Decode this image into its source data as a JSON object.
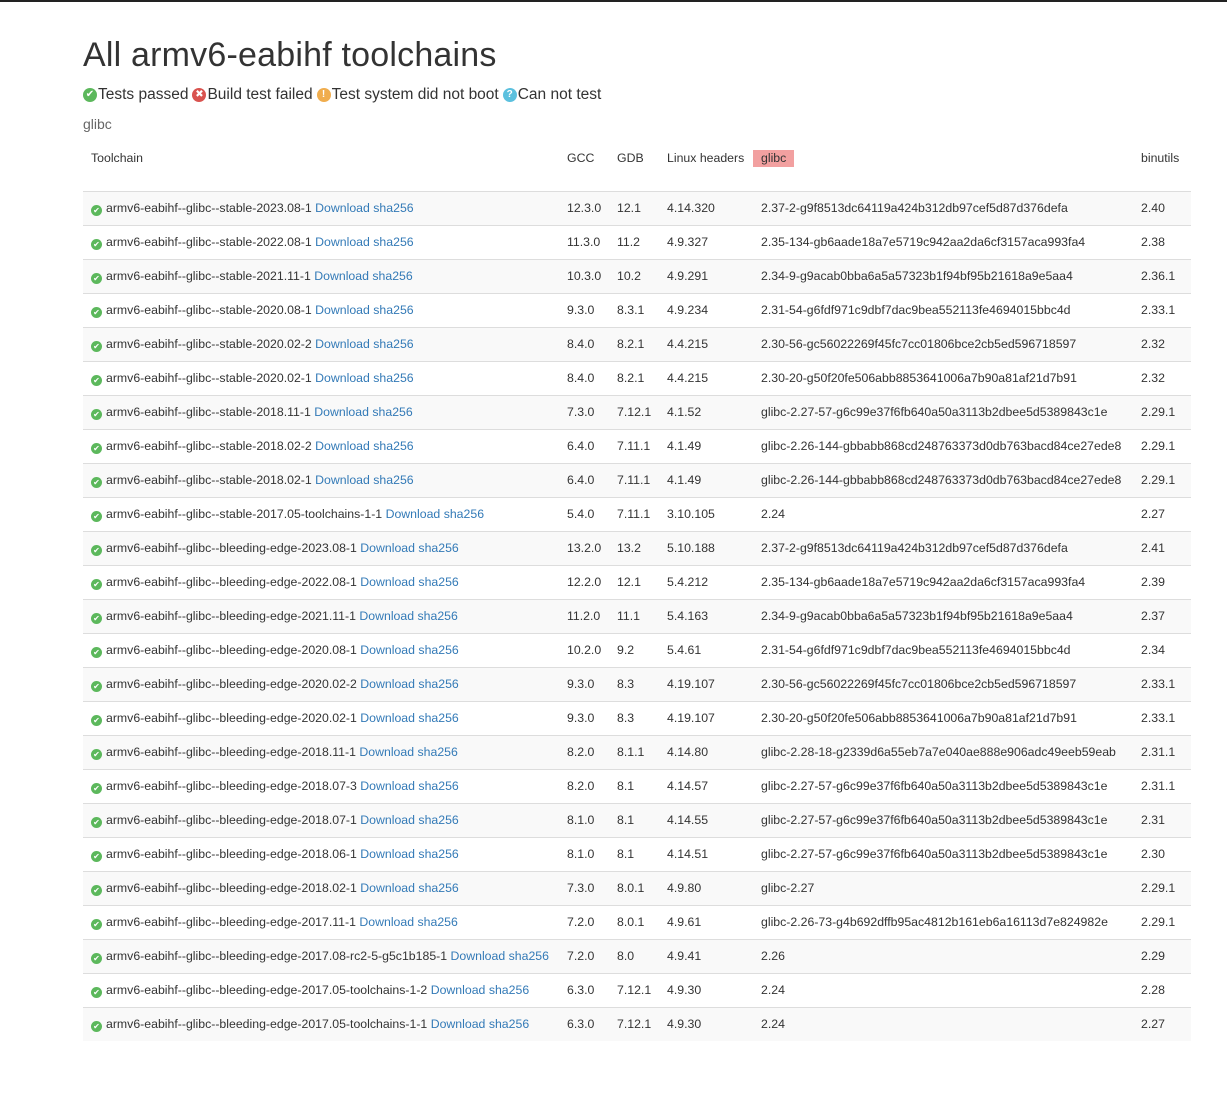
{
  "page": {
    "title": "All armv6-eabihf toolchains",
    "subtitle": "glibc"
  },
  "legend": [
    {
      "icon": "check-circle-icon",
      "label": "Tests passed",
      "color": "#5cb85c"
    },
    {
      "icon": "cross-circle-icon",
      "label": "Build test failed",
      "color": "#d9534f"
    },
    {
      "icon": "exclamation-circle-icon",
      "label": "Test system did not boot",
      "color": "#f0ad4e"
    },
    {
      "icon": "question-circle-icon",
      "label": "Can not test",
      "color": "#5bc0de"
    }
  ],
  "table": {
    "headers": {
      "toolchain": "Toolchain",
      "gcc": "GCC",
      "gdb": "GDB",
      "linux": "Linux headers",
      "glibc": "glibc",
      "binutils": "binutils"
    },
    "download_label": "Download",
    "sha_label": "sha256",
    "rows": [
      {
        "name": "armv6-eabihf--glibc--stable-2023.08-1",
        "gcc": "12.3.0",
        "gdb": "12.1",
        "linux": "4.14.320",
        "glibc": "2.37-2-g9f8513dc64119a424b312db97cef5d87d376defa",
        "binutils": "2.40"
      },
      {
        "name": "armv6-eabihf--glibc--stable-2022.08-1",
        "gcc": "11.3.0",
        "gdb": "11.2",
        "linux": "4.9.327",
        "glibc": "2.35-134-gb6aade18a7e5719c942aa2da6cf3157aca993fa4",
        "binutils": "2.38"
      },
      {
        "name": "armv6-eabihf--glibc--stable-2021.11-1",
        "gcc": "10.3.0",
        "gdb": "10.2",
        "linux": "4.9.291",
        "glibc": "2.34-9-g9acab0bba6a5a57323b1f94bf95b21618a9e5aa4",
        "binutils": "2.36.1"
      },
      {
        "name": "armv6-eabihf--glibc--stable-2020.08-1",
        "gcc": "9.3.0",
        "gdb": "8.3.1",
        "linux": "4.9.234",
        "glibc": "2.31-54-g6fdf971c9dbf7dac9bea552113fe4694015bbc4d",
        "binutils": "2.33.1"
      },
      {
        "name": "armv6-eabihf--glibc--stable-2020.02-2",
        "gcc": "8.4.0",
        "gdb": "8.2.1",
        "linux": "4.4.215",
        "glibc": "2.30-56-gc56022269f45fc7cc01806bce2cb5ed596718597",
        "binutils": "2.32"
      },
      {
        "name": "armv6-eabihf--glibc--stable-2020.02-1",
        "gcc": "8.4.0",
        "gdb": "8.2.1",
        "linux": "4.4.215",
        "glibc": "2.30-20-g50f20fe506abb8853641006a7b90a81af21d7b91",
        "binutils": "2.32"
      },
      {
        "name": "armv6-eabihf--glibc--stable-2018.11-1",
        "gcc": "7.3.0",
        "gdb": "7.12.1",
        "linux": "4.1.52",
        "glibc": "glibc-2.27-57-g6c99e37f6fb640a50a3113b2dbee5d5389843c1e",
        "binutils": "2.29.1"
      },
      {
        "name": "armv6-eabihf--glibc--stable-2018.02-2",
        "gcc": "6.4.0",
        "gdb": "7.11.1",
        "linux": "4.1.49",
        "glibc": "glibc-2.26-144-gbbabb868cd248763373d0db763bacd84ce27ede8",
        "binutils": "2.29.1"
      },
      {
        "name": "armv6-eabihf--glibc--stable-2018.02-1",
        "gcc": "6.4.0",
        "gdb": "7.11.1",
        "linux": "4.1.49",
        "glibc": "glibc-2.26-144-gbbabb868cd248763373d0db763bacd84ce27ede8",
        "binutils": "2.29.1"
      },
      {
        "name": "armv6-eabihf--glibc--stable-2017.05-toolchains-1-1",
        "gcc": "5.4.0",
        "gdb": "7.11.1",
        "linux": "3.10.105",
        "glibc": "2.24",
        "binutils": "2.27"
      },
      {
        "name": "armv6-eabihf--glibc--bleeding-edge-2023.08-1",
        "gcc": "13.2.0",
        "gdb": "13.2",
        "linux": "5.10.188",
        "glibc": "2.37-2-g9f8513dc64119a424b312db97cef5d87d376defa",
        "binutils": "2.41"
      },
      {
        "name": "armv6-eabihf--glibc--bleeding-edge-2022.08-1",
        "gcc": "12.2.0",
        "gdb": "12.1",
        "linux": "5.4.212",
        "glibc": "2.35-134-gb6aade18a7e5719c942aa2da6cf3157aca993fa4",
        "binutils": "2.39"
      },
      {
        "name": "armv6-eabihf--glibc--bleeding-edge-2021.11-1",
        "gcc": "11.2.0",
        "gdb": "11.1",
        "linux": "5.4.163",
        "glibc": "2.34-9-g9acab0bba6a5a57323b1f94bf95b21618a9e5aa4",
        "binutils": "2.37"
      },
      {
        "name": "armv6-eabihf--glibc--bleeding-edge-2020.08-1",
        "gcc": "10.2.0",
        "gdb": "9.2",
        "linux": "5.4.61",
        "glibc": "2.31-54-g6fdf971c9dbf7dac9bea552113fe4694015bbc4d",
        "binutils": "2.34"
      },
      {
        "name": "armv6-eabihf--glibc--bleeding-edge-2020.02-2",
        "gcc": "9.3.0",
        "gdb": "8.3",
        "linux": "4.19.107",
        "glibc": "2.30-56-gc56022269f45fc7cc01806bce2cb5ed596718597",
        "binutils": "2.33.1"
      },
      {
        "name": "armv6-eabihf--glibc--bleeding-edge-2020.02-1",
        "gcc": "9.3.0",
        "gdb": "8.3",
        "linux": "4.19.107",
        "glibc": "2.30-20-g50f20fe506abb8853641006a7b90a81af21d7b91",
        "binutils": "2.33.1"
      },
      {
        "name": "armv6-eabihf--glibc--bleeding-edge-2018.11-1",
        "gcc": "8.2.0",
        "gdb": "8.1.1",
        "linux": "4.14.80",
        "glibc": "glibc-2.28-18-g2339d6a55eb7a7e040ae888e906adc49eeb59eab",
        "binutils": "2.31.1"
      },
      {
        "name": "armv6-eabihf--glibc--bleeding-edge-2018.07-3",
        "gcc": "8.2.0",
        "gdb": "8.1",
        "linux": "4.14.57",
        "glibc": "glibc-2.27-57-g6c99e37f6fb640a50a3113b2dbee5d5389843c1e",
        "binutils": "2.31.1"
      },
      {
        "name": "armv6-eabihf--glibc--bleeding-edge-2018.07-1",
        "gcc": "8.1.0",
        "gdb": "8.1",
        "linux": "4.14.55",
        "glibc": "glibc-2.27-57-g6c99e37f6fb640a50a3113b2dbee5d5389843c1e",
        "binutils": "2.31"
      },
      {
        "name": "armv6-eabihf--glibc--bleeding-edge-2018.06-1",
        "gcc": "8.1.0",
        "gdb": "8.1",
        "linux": "4.14.51",
        "glibc": "glibc-2.27-57-g6c99e37f6fb640a50a3113b2dbee5d5389843c1e",
        "binutils": "2.30"
      },
      {
        "name": "armv6-eabihf--glibc--bleeding-edge-2018.02-1",
        "gcc": "7.3.0",
        "gdb": "8.0.1",
        "linux": "4.9.80",
        "glibc": "glibc-2.27",
        "binutils": "2.29.1"
      },
      {
        "name": "armv6-eabihf--glibc--bleeding-edge-2017.11-1",
        "gcc": "7.2.0",
        "gdb": "8.0.1",
        "linux": "4.9.61",
        "glibc": "glibc-2.26-73-g4b692dffb95ac4812b161eb6a16113d7e824982e",
        "binutils": "2.29.1"
      },
      {
        "name": "armv6-eabihf--glibc--bleeding-edge-2017.08-rc2-5-g5c1b185-1",
        "gcc": "7.2.0",
        "gdb": "8.0",
        "linux": "4.9.41",
        "glibc": "2.26",
        "binutils": "2.29"
      },
      {
        "name": "armv6-eabihf--glibc--bleeding-edge-2017.05-toolchains-1-2",
        "gcc": "6.3.0",
        "gdb": "7.12.1",
        "linux": "4.9.30",
        "glibc": "2.24",
        "binutils": "2.28"
      },
      {
        "name": "armv6-eabihf--glibc--bleeding-edge-2017.05-toolchains-1-1",
        "gcc": "6.3.0",
        "gdb": "7.12.1",
        "linux": "4.9.30",
        "glibc": "2.24",
        "binutils": "2.27"
      }
    ]
  }
}
